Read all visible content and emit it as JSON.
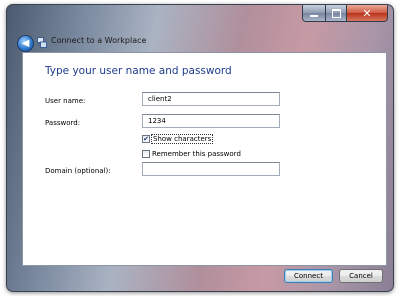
{
  "window": {
    "title": "Connect to a Workplace",
    "caption": {
      "minimize": "",
      "maximize": "",
      "close": "✕"
    }
  },
  "form": {
    "heading": "Type your user name and password",
    "username": {
      "label": "User name:",
      "value": "client2"
    },
    "password": {
      "label": "Password:",
      "value": "1234"
    },
    "show_characters": {
      "label": "Show characters",
      "checked": true,
      "mark": "✔"
    },
    "remember_password": {
      "label": "Remember this password",
      "checked": false
    },
    "domain": {
      "label": "Domain (optional):",
      "value": ""
    }
  },
  "buttons": {
    "connect": "Connect",
    "cancel": "Cancel"
  },
  "icons": {
    "back": "back-arrow-icon",
    "title": "network-icon"
  }
}
